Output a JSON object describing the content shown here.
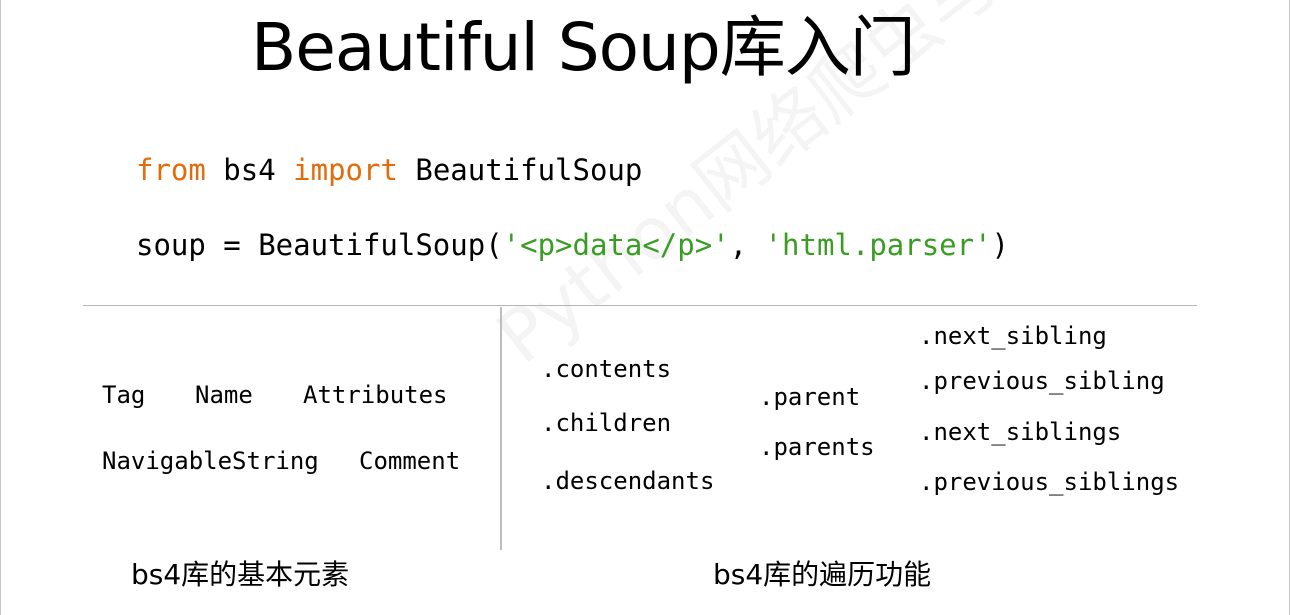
{
  "title": "Beautiful Soup库入门",
  "code": {
    "line1": {
      "kw_from": "from",
      "mod": " bs4 ",
      "kw_import": "import",
      "cls": " BeautifulSoup"
    },
    "line2": {
      "prefix": "soup = BeautifulSoup(",
      "arg1": "'<p>data</p>'",
      "sep": ", ",
      "arg2": "'html.parser'",
      "suffix": ")"
    }
  },
  "elements": {
    "tag": "Tag",
    "name": "Name",
    "attributes": "Attributes",
    "navigable_string": "NavigableString",
    "comment": "Comment"
  },
  "traversal": {
    "down": [
      ".contents",
      ".children",
      ".descendants"
    ],
    "up": [
      ".parent",
      ".parents"
    ],
    "sibling": [
      ".next_sibling",
      ".previous_sibling",
      ".next_siblings",
      ".previous_siblings"
    ]
  },
  "captions": {
    "left": "bs4库的基本元素",
    "right": "bs4库的遍历功能"
  },
  "watermark": "Python网络爬虫与信息提取",
  "colors": {
    "keyword": "#e26b0a",
    "string": "#3a9d23",
    "text": "#000000"
  }
}
